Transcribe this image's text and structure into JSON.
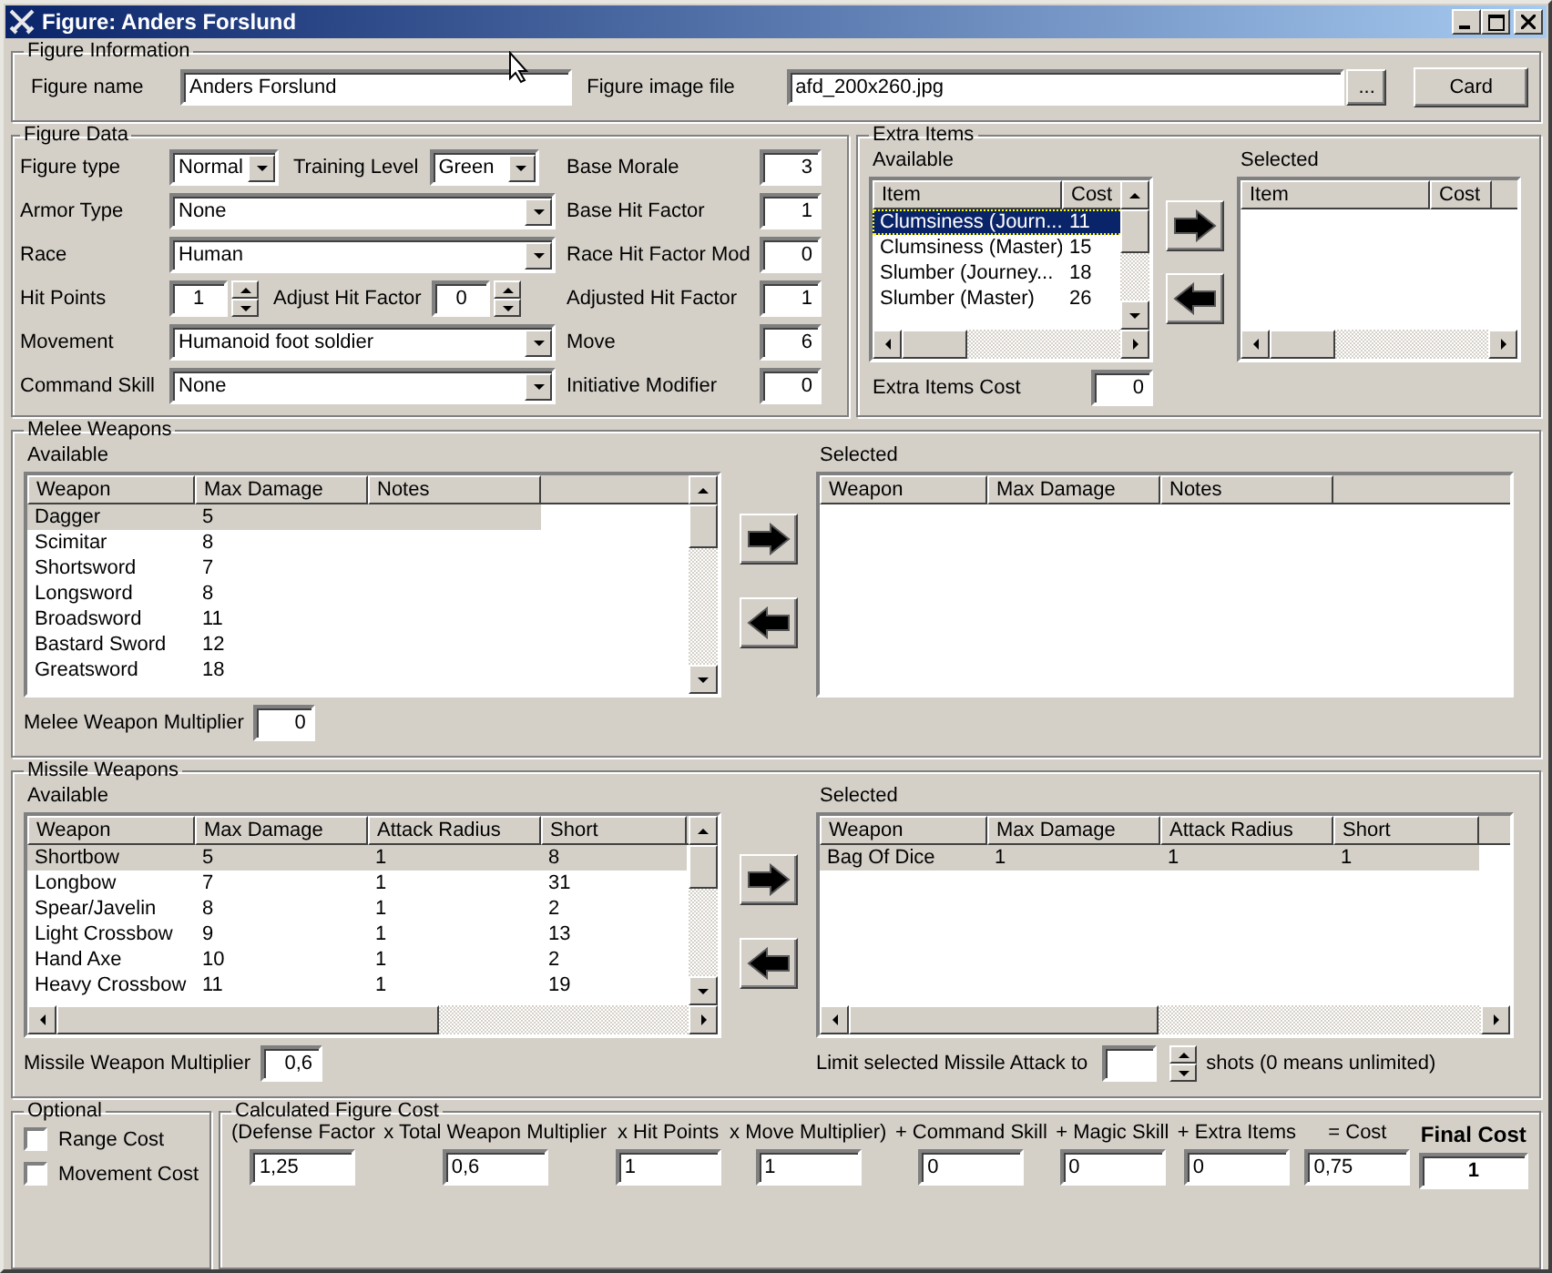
{
  "window": {
    "title": "Figure: Anders Forslund"
  },
  "figure_information": {
    "title": "Figure Information",
    "name_label": "Figure name",
    "name_value": "Anders Forslund",
    "image_label": "Figure image file",
    "image_value": "afd_200x260.jpg",
    "browse_button": "...",
    "card_button": "Card"
  },
  "figure_data": {
    "title": "Figure Data",
    "rows": [
      {
        "controls": [
          {
            "kind": "dropdown",
            "label": "Figure type",
            "value": "Normal"
          },
          {
            "kind": "dropdown",
            "label": "Training Level",
            "value": "Green"
          }
        ]
      },
      {
        "controls": [
          {
            "kind": "dropdown",
            "label": "Armor Type",
            "value": "None"
          }
        ]
      },
      {
        "controls": [
          {
            "kind": "dropdown",
            "label": "Race",
            "value": "Human"
          }
        ]
      },
      {
        "controls": [
          {
            "kind": "spinner",
            "label": "Hit Points",
            "value": "1"
          },
          {
            "kind": "spinner",
            "label": "Adjust Hit Factor",
            "value": "0"
          }
        ]
      },
      {
        "controls": [
          {
            "kind": "dropdown",
            "label": "Movement",
            "value": "Humanoid foot soldier"
          }
        ]
      },
      {
        "controls": [
          {
            "kind": "dropdown",
            "label": "Command Skill",
            "value": "None"
          }
        ]
      }
    ],
    "stats": [
      {
        "label": "Base Morale",
        "value": "3"
      },
      {
        "label": "Base Hit Factor",
        "value": "1"
      },
      {
        "label": "Race Hit Factor Mod",
        "value": "0"
      },
      {
        "label": "Adjusted Hit Factor",
        "value": "1"
      },
      {
        "label": "Move",
        "value": "6"
      },
      {
        "label": "Initiative Modifier",
        "value": "0"
      }
    ]
  },
  "extra_items": {
    "title": "Extra Items",
    "available": {
      "label": "Available",
      "focused": true,
      "columns": [
        "Item",
        "Cost"
      ],
      "rows": [
        {
          "cells": [
            "Clumsiness (Journ...",
            "11"
          ],
          "selected": true
        },
        {
          "cells": [
            "Clumsiness (Master)",
            "15"
          ],
          "selected": false
        },
        {
          "cells": [
            "Slumber (Journey...",
            "18"
          ],
          "selected": false
        },
        {
          "cells": [
            "Slumber (Master)",
            "26"
          ],
          "selected": false
        }
      ]
    },
    "selected": {
      "label": "Selected",
      "columns": [
        "Item",
        "Cost"
      ]
    },
    "cost_label": "Extra Items Cost",
    "cost_value": "0"
  },
  "weapon_groups": [
    {
      "title": "Melee Weapons",
      "available": {
        "label": "Available",
        "focused": false,
        "columns": [
          "Weapon",
          "Max Damage",
          "Notes"
        ],
        "rows": [
          {
            "cells": [
              "Dagger",
              "5"
            ],
            "selected": true
          },
          {
            "cells": [
              "Scimitar",
              "8"
            ],
            "selected": false
          },
          {
            "cells": [
              "Shortsword",
              "7"
            ],
            "selected": false
          },
          {
            "cells": [
              "Longsword",
              "8"
            ],
            "selected": false
          },
          {
            "cells": [
              "Broadsword",
              "11"
            ],
            "selected": false
          },
          {
            "cells": [
              "Bastard Sword",
              "12"
            ],
            "selected": false
          },
          {
            "cells": [
              "Greatsword",
              "18"
            ],
            "selected": false
          }
        ]
      },
      "selected": {
        "label": "Selected",
        "columns": [
          "Weapon",
          "Max Damage",
          "Notes"
        ]
      },
      "multiplier_label": "Melee Weapon Multiplier",
      "multiplier_value": "0"
    },
    {
      "title": "Missile Weapons",
      "available": {
        "label": "Available",
        "focused": false,
        "columns": [
          "Weapon",
          "Max Damage",
          "Attack Radius",
          "Short"
        ],
        "rows": [
          {
            "cells": [
              "Shortbow",
              "5",
              "1",
              "8"
            ],
            "selected": true
          },
          {
            "cells": [
              "Longbow",
              "7",
              "1",
              "31"
            ],
            "selected": false
          },
          {
            "cells": [
              "Spear/Javelin",
              "8",
              "1",
              "2"
            ],
            "selected": false
          },
          {
            "cells": [
              "Light Crossbow",
              "9",
              "1",
              "13"
            ],
            "selected": false
          },
          {
            "cells": [
              "Hand Axe",
              "10",
              "1",
              "2"
            ],
            "selected": false
          },
          {
            "cells": [
              "Heavy Crossbow",
              "11",
              "1",
              "19"
            ],
            "selected": false
          }
        ]
      },
      "selected": {
        "label": "Selected",
        "focused": false,
        "columns": [
          "Weapon",
          "Max Damage",
          "Attack Radius",
          "Short"
        ],
        "rows": [
          {
            "cells": [
              "Bag Of Dice",
              "1",
              "1",
              "1"
            ],
            "selected": true
          }
        ]
      },
      "multiplier_label": "Missile Weapon Multiplier",
      "multiplier_value": "0,6",
      "limit": {
        "label": "Limit selected Missile Attack to",
        "suffix": "shots (0 means unlimited)"
      }
    }
  ],
  "optional": {
    "title": "Optional",
    "options": [
      {
        "label": "Range Cost",
        "checked": false
      },
      {
        "label": "Movement Cost",
        "checked": false
      }
    ]
  },
  "calculated_cost": {
    "title": "Calculated Figure Cost",
    "terms": [
      {
        "kind": "term",
        "label": "(Defense Factor",
        "value": "1,25"
      },
      {
        "kind": "term",
        "label": "x Total Weapon Multiplier",
        "value": "0,6"
      },
      {
        "kind": "term",
        "label": "x Hit Points",
        "value": "1"
      },
      {
        "kind": "term",
        "label": "x Move Multiplier)",
        "value": "1"
      },
      {
        "kind": "term",
        "label": "+ Command Skill",
        "value": "0"
      },
      {
        "kind": "term",
        "label": "+ Magic Skill",
        "value": "0"
      },
      {
        "kind": "term",
        "label": "+ Extra Items",
        "value": "0"
      },
      {
        "kind": "term",
        "label": "= Cost",
        "value": "0,75"
      },
      {
        "kind": "final",
        "label": "Final Cost",
        "value": "1"
      }
    ]
  }
}
